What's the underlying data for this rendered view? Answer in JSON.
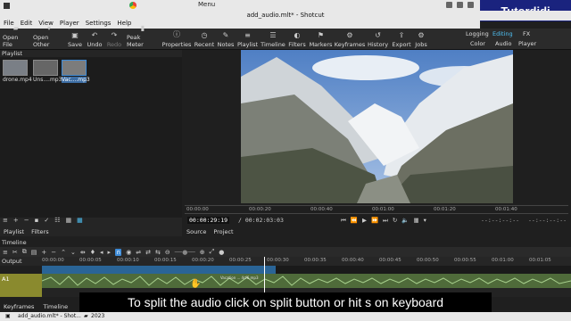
{
  "system": {
    "menu_label": "Menu",
    "brand": "Tutordidi"
  },
  "window": {
    "title": "add_audio.mlt* - Shotcut"
  },
  "menubar": [
    "File",
    "Edit",
    "View",
    "Player",
    "Settings",
    "Help"
  ],
  "toolbar": [
    {
      "label": "Open File",
      "icon": "folder-open-icon"
    },
    {
      "label": "Open Other",
      "icon": "open-other-icon"
    },
    {
      "label": "Save",
      "icon": "save-icon"
    },
    {
      "label": "Undo",
      "icon": "undo-icon"
    },
    {
      "label": "Redo",
      "icon": "redo-icon"
    },
    {
      "label": "Peak Meter",
      "icon": "peak-meter-icon"
    },
    {
      "label": "Properties",
      "icon": "properties-icon"
    },
    {
      "label": "Recent",
      "icon": "recent-icon"
    },
    {
      "label": "Notes",
      "icon": "notes-icon"
    },
    {
      "label": "Playlist",
      "icon": "playlist-icon"
    },
    {
      "label": "Timeline",
      "icon": "timeline-icon"
    },
    {
      "label": "Filters",
      "icon": "filters-icon"
    },
    {
      "label": "Markers",
      "icon": "markers-icon"
    },
    {
      "label": "Keyframes",
      "icon": "keyframes-icon"
    },
    {
      "label": "History",
      "icon": "history-icon"
    },
    {
      "label": "Export",
      "icon": "export-icon"
    },
    {
      "label": "Jobs",
      "icon": "jobs-icon"
    }
  ],
  "layouts": {
    "row1": [
      "Logging",
      "Editing",
      "FX"
    ],
    "row2": [
      "Color",
      "Audio",
      "Player"
    ],
    "active": "Editing"
  },
  "playlist": {
    "title": "Playlist",
    "clips": [
      {
        "label": "drone.mp4",
        "selected": false
      },
      {
        "label": "Uns....mp3",
        "selected": false
      },
      {
        "label": "Vac....mp3",
        "selected": true
      }
    ],
    "tabs": [
      "Playlist",
      "Filters"
    ]
  },
  "player": {
    "ruler": [
      "00:00:00",
      "00:00:20",
      "00:00:40",
      "00:01:00",
      "00:01:20",
      "00:01:40"
    ],
    "current_time": "00:00:29:19",
    "total_time": "/ 00:02:03:03",
    "in_point": "--:--:--:--",
    "out_point": "--:--:--:--",
    "tabs": [
      "Source",
      "Project"
    ]
  },
  "timeline": {
    "label": "Timeline",
    "output_label": "Output",
    "track_a1": "A1",
    "ruler": [
      "00:00:00",
      "00:00:05",
      "00:00:10",
      "00:00:15",
      "00:00:20",
      "00:00:25",
      "00:00:30",
      "00:00:35",
      "00:00:40",
      "00:00:45",
      "00:00:50",
      "00:00:55",
      "00:01:00",
      "00:01:05"
    ],
    "audio_clip_label": "Vacation ... 4cf6.mp3"
  },
  "subtitle": "To split the audio click on split button or hit s on keyboard",
  "bottom_tabs": [
    "Keyframes",
    "Timeline"
  ],
  "taskbar": {
    "item1": "add_audio.mlt* - Shot...",
    "item2": "2023"
  },
  "colors": {
    "accent": "#3d8bd8",
    "audio_track": "#8a8a2e",
    "video_clip": "#2a6496",
    "brand_bg": "#1a237e"
  }
}
